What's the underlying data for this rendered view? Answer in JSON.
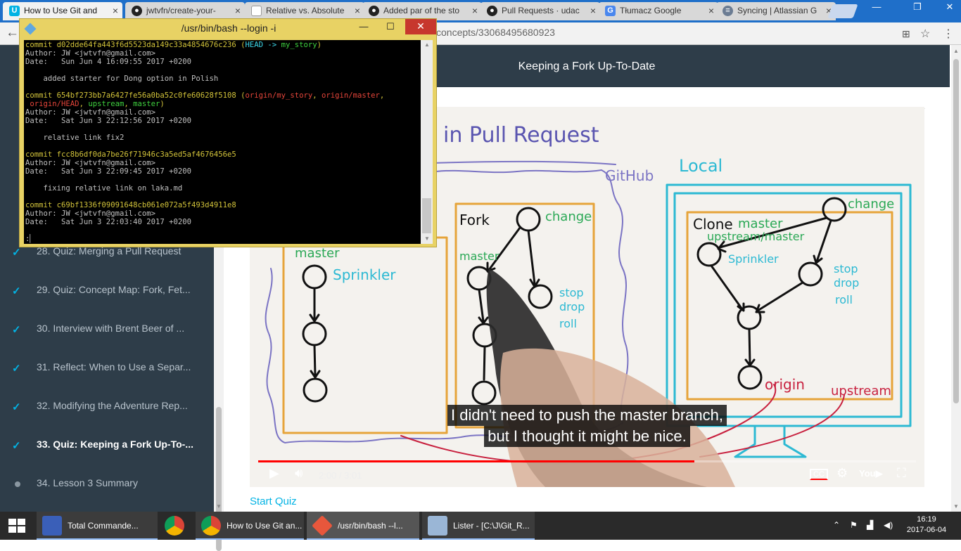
{
  "browser": {
    "tabs": [
      {
        "title": "How to Use Git and",
        "icon": "udacity-icon",
        "active": true
      },
      {
        "title": "jwtvfn/create-your-",
        "icon": "github-icon",
        "active": false
      },
      {
        "title": "Relative vs. Absolute",
        "icon": "document-icon",
        "active": false
      },
      {
        "title": "Added par of the sto",
        "icon": "github-icon",
        "active": false
      },
      {
        "title": "Pull Requests · udac",
        "icon": "github-icon",
        "active": false
      },
      {
        "title": "Tłumacz Google",
        "icon": "google-translate-icon",
        "active": false
      },
      {
        "title": "Syncing | Atlassian G",
        "icon": "database-icon",
        "active": false
      }
    ],
    "url": "concepts/33068495680923"
  },
  "course": {
    "header_title": "Keeping a Fork Up-To-Date",
    "lessons": [
      {
        "label": "28. Quiz: Merging a Pull Request",
        "state": "done"
      },
      {
        "label": "29. Quiz: Concept Map: Fork, Fet...",
        "state": "done"
      },
      {
        "label": "30. Interview with Brent Beer of ...",
        "state": "done"
      },
      {
        "label": "31. Reflect: When to Use a Separ...",
        "state": "done"
      },
      {
        "label": "32. Modifying the Adventure Rep...",
        "state": "done"
      },
      {
        "label": "33. Quiz: Keeping a Fork Up-To-...",
        "state": "current"
      },
      {
        "label": "34. Lesson 3 Summary",
        "state": "todo"
      }
    ],
    "start_quiz": "Start Quiz"
  },
  "video": {
    "subtitle_line1": "I didn't need to push the master branch,",
    "subtitle_line2": "but I thought it might be nice.",
    "time": "2:00 / 3:01",
    "progress": 0.663,
    "drawing": {
      "title": "in Pull Request",
      "github_label": "GitHub",
      "local_label": "Local",
      "fork_label": "Fork",
      "clone_label": "Clone",
      "master": "master",
      "sprinkler": "Sprinkler",
      "change": "change",
      "stop_drop_roll": [
        "stop",
        "drop",
        "roll"
      ],
      "upstream_master": "upstream/master",
      "origin": "origin",
      "upstream": "upstream"
    }
  },
  "bash": {
    "title": "/usr/bin/bash --login -i",
    "commits": [
      {
        "hash": "d02dde64fa443f6d5523da149c33a4854676c236",
        "author": "JW <jwtvfn@gmail.com>",
        "date": "Sun Jun 4 16:09:55 2017 +0200",
        "message": "added starter for Dong option in Polish"
      },
      {
        "hash": "654bf273bb7a6427fe56a0ba52c0fe60628f5108",
        "author": "JW <jwtvfn@gmail.com>",
        "date": "Sat Jun 3 22:12:56 2017 +0200",
        "message": "relative link fix2"
      },
      {
        "hash": "fcc8b6df0da7be26f71946c3a5ed5af4676456e5",
        "author": "JW <jwtvfn@gmail.com>",
        "date": "Sat Jun 3 22:09:45 2017 +0200",
        "message": "fixing relative link on laka.md"
      },
      {
        "hash": "c69bf1336f09091648cb061e072a5f493d4911e8",
        "author": "JW <jwtvfn@gmail.com>",
        "date": "Sat Jun 3 22:03:40 2017 +0200",
        "message": ""
      }
    ],
    "refs1": {
      "head": "HEAD ->",
      "branch": "my_story"
    },
    "refs2": {
      "origin_my_story": "origin/my_story",
      "origin_master": "origin/master",
      "origin_head": "origin/HEAD",
      "upstream": "upstream",
      "master": "master"
    },
    "prompt": ":"
  },
  "taskbar": {
    "items": [
      {
        "label": "Total Commande...",
        "icon": "floppy-icon"
      },
      {
        "label": "",
        "icon": "chrome-icon"
      },
      {
        "label": "How to Use Git an...",
        "icon": "chrome-icon"
      },
      {
        "label": "/usr/bin/bash --l...",
        "icon": "git-bash-icon"
      },
      {
        "label": "Lister - [C:\\J\\Git_R...",
        "icon": "lister-icon"
      }
    ],
    "time": "16:19",
    "date": "2017-06-04"
  }
}
